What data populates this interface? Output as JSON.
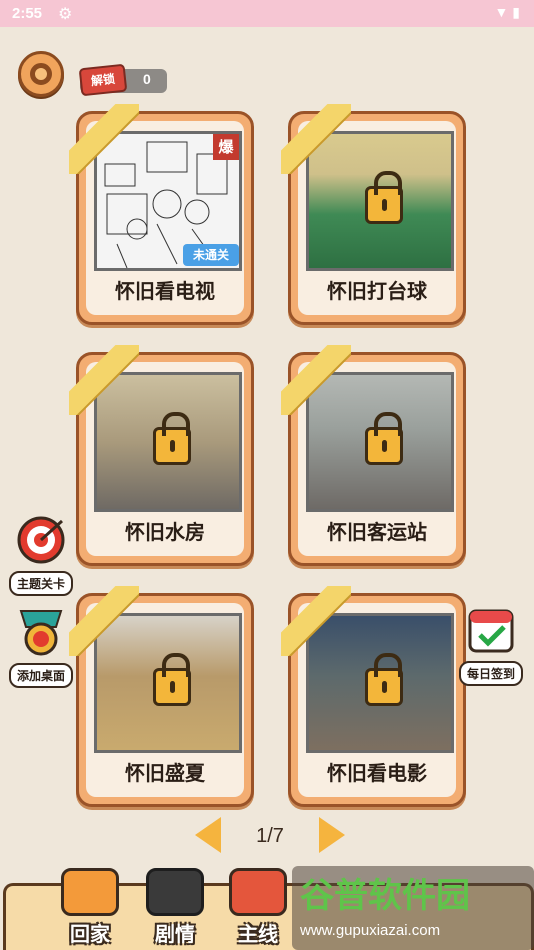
{
  "status_bar": {
    "time": "2:55",
    "right_icons": "▼ ▮"
  },
  "header": {
    "unlock_label": "解锁",
    "unlock_count": "0"
  },
  "levels": [
    {
      "title": "怀旧看电视",
      "locked": false,
      "badge_top": "爆",
      "badge_bottom": "未通关"
    },
    {
      "title": "怀旧打台球",
      "locked": true
    },
    {
      "title": "怀旧水房",
      "locked": true
    },
    {
      "title": "怀旧客运站",
      "locked": true
    },
    {
      "title": "怀旧盛夏",
      "locked": true
    },
    {
      "title": "怀旧看电影",
      "locked": true
    }
  ],
  "side_buttons": {
    "theme": "主题关卡",
    "add_desktop": "添加桌面",
    "daily": "每日签到"
  },
  "pager": {
    "label": "1/7"
  },
  "tabs": {
    "home": "回家",
    "story": "剧情",
    "main": "主线"
  },
  "watermark": {
    "title": "谷普软件园",
    "url": "www.gupuxiazai.com"
  },
  "colors": {
    "status_bar": "#f6c6d3",
    "background": "#efe7da",
    "card": "#f3ad72",
    "ribbon": "#f4d56a"
  }
}
